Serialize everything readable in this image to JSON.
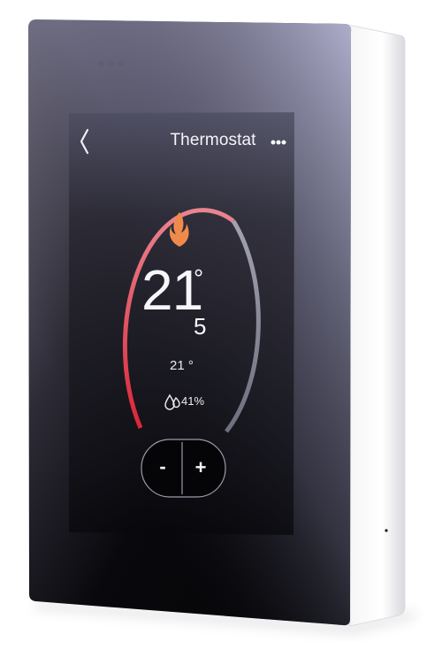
{
  "screen": {
    "title": "Thermostat",
    "current_temp_whole": "21",
    "current_temp_degree": "°",
    "current_temp_decimal": "5",
    "setpoint": "21 °",
    "humidity": "41%"
  },
  "controls": {
    "decrease_label": "-",
    "increase_label": "+"
  },
  "icons": {
    "back": "chevron-left-icon",
    "menu": "more-dots-icon",
    "mode": "flame-icon",
    "humidity": "humidity-droplet-icon"
  },
  "colors": {
    "arc_heating": "#e8616a",
    "arc_idle": "#8f8e9f",
    "flame": "#f08a4b",
    "screen_dark": "#0b0b10",
    "screen_glass": "#a7a7c7"
  }
}
